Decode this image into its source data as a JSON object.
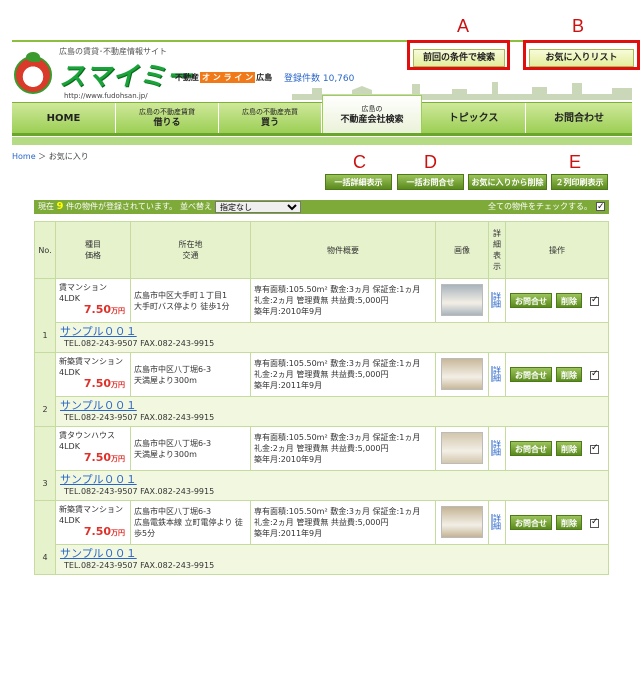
{
  "header": {
    "tagline": "広島の賃貸･不動産情報サイト",
    "logo_text": "スマイミー",
    "logo_url": "http://www.fudohsan.jp/",
    "sub_brand_prefix": "不動産",
    "sub_brand_mid": "オ ン ラ イ ン",
    "sub_brand_suffix": "広島",
    "count_label": "登録件数 10,760",
    "btn_prev_search": "前回の条件で検索",
    "btn_favorites": "お気に入りリスト"
  },
  "annotations": {
    "a": "A",
    "b": "B",
    "c": "C",
    "d": "D",
    "e": "E"
  },
  "nav": [
    {
      "small": "",
      "label": "HOME"
    },
    {
      "small": "広島の不動産賃貸",
      "label": "借りる"
    },
    {
      "small": "広島の不動産売買",
      "label": "買う"
    },
    {
      "small": "広島の",
      "label": "不動産会社検索"
    },
    {
      "small": "",
      "label": "トピックス"
    },
    {
      "small": "",
      "label": "お問合わせ"
    }
  ],
  "breadcrumb": {
    "home": "Home",
    "sep": "＞",
    "current": "お気に入り"
  },
  "actions": {
    "bulk_detail": "一括詳細表示",
    "bulk_inquiry": "一括お問合せ",
    "remove_favorites": "お気に入りから削除",
    "print_2col": "２列印刷表示"
  },
  "status": {
    "prefix": "現在",
    "count": "9",
    "suffix": "件の物件が登録されています。",
    "sort_label": "並べ替え",
    "sort_value": "指定なし",
    "check_all": "全ての物件をチェックする。"
  },
  "table_headers": {
    "no": "No.",
    "type": "種目",
    "price": "価格",
    "addr": "所在地",
    "access": "交通",
    "summary": "物件概要",
    "image": "画像",
    "detail": "詳細表示",
    "ops": "操作"
  },
  "row_labels": {
    "inquiry": "お問合せ",
    "delete": "削除",
    "detail_link": "詳細"
  },
  "rows": [
    {
      "no": "1",
      "type": "賃マンション",
      "layout": "4LDK",
      "price": "7.50",
      "unit": "万円",
      "addr": "広島市中区大手町１丁目1",
      "access": "大手町バス停より 徒歩1分",
      "spec1": "専有面積:105.50m² 敷金:3ヵ月 保証金:1ヵ月",
      "spec2": "礼金:2ヵ月 管理費無 共益費:5,000円",
      "spec3": "築年月:2010年9月",
      "shop": "サンプル００１",
      "tel": "TEL.082-243-9507 FAX.082-243-9915",
      "thumb_color": "#a8b4bc"
    },
    {
      "no": "2",
      "type": "新築賃マンション",
      "layout": "4LDK",
      "price": "7.50",
      "unit": "万円",
      "addr": "広島市中区八丁堀6-3",
      "access": "天満屋より300m",
      "spec1": "専有面積:105.50m² 敷金:3ヵ月 保証金:1ヵ月",
      "spec2": "礼金:2ヵ月 管理費無 共益費:5,000円",
      "spec3": "築年月:2011年9月",
      "shop": "サンプル００１",
      "tel": "TEL.082-243-9507 FAX.082-243-9915",
      "thumb_color": "#c8b89a"
    },
    {
      "no": "3",
      "type": "賃タウンハウス",
      "layout": "4LDK",
      "price": "7.50",
      "unit": "万円",
      "addr": "広島市中区八丁堀6-3",
      "access": "天満屋より300m",
      "spec1": "専有面積:105.50m² 敷金:3ヵ月 保証金:1ヵ月",
      "spec2": "礼金:2ヵ月 管理費無 共益費:5,000円",
      "spec3": "築年月:2010年9月",
      "shop": "サンプル００１",
      "tel": "TEL.082-243-9507 FAX.082-243-9915",
      "thumb_color": "#d2c6ac"
    },
    {
      "no": "4",
      "type": "新築賃マンション",
      "layout": "4LDK",
      "price": "7.50",
      "unit": "万円",
      "addr": "広島市中区八丁堀6-3",
      "access": "広島電鉄本線 立町電停より 徒歩5分",
      "spec1": "専有面積:105.50m² 敷金:3ヵ月 保証金:1ヵ月",
      "spec2": "礼金:2ヵ月 管理費無 共益費:5,000円",
      "spec3": "築年月:2011年9月",
      "shop": "サンプル００１",
      "tel": "TEL.082-243-9507 FAX.082-243-9915",
      "thumb_color": "#c4b494"
    }
  ]
}
